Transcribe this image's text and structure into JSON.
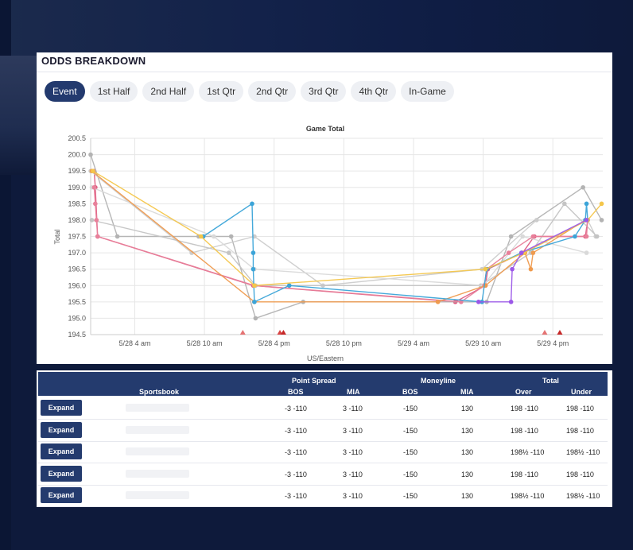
{
  "panel": {
    "title": "ODDS BREAKDOWN"
  },
  "tabs": [
    {
      "label": "Event",
      "active": true
    },
    {
      "label": "1st Half",
      "active": false
    },
    {
      "label": "2nd Half",
      "active": false
    },
    {
      "label": "1st Qtr",
      "active": false
    },
    {
      "label": "2nd Qtr",
      "active": false
    },
    {
      "label": "3rd Qtr",
      "active": false
    },
    {
      "label": "4th Qtr",
      "active": false
    },
    {
      "label": "In-Game",
      "active": false
    }
  ],
  "chart_data": {
    "type": "line",
    "title": "Game Total",
    "xlabel": "US/Eastern",
    "ylabel": "Total",
    "ylim": [
      194.5,
      200.5
    ],
    "yticks": [
      "200.5",
      "200.0",
      "199.5",
      "199.0",
      "198.5",
      "198.0",
      "197.5",
      "197.0",
      "196.5",
      "196.0",
      "195.5",
      "195.0",
      "194.5"
    ],
    "xticks": [
      "5/28 4 am",
      "5/28 10 am",
      "5/28 4 pm",
      "5/28 10 pm",
      "5/29 4 am",
      "5/29 10 am",
      "5/29 4 pm"
    ],
    "xticks_hours": [
      4,
      10,
      16,
      22,
      28,
      34,
      40
    ],
    "xlim_hours": [
      0.2,
      44.3
    ],
    "grid": true,
    "series": [
      {
        "color": "#e8809a",
        "points": [
          [
            0.5,
            199.0
          ],
          [
            0.6,
            198.5
          ],
          [
            0.7,
            198.0
          ],
          [
            0.8,
            197.5
          ],
          [
            14.3,
            196.0
          ],
          [
            32.1,
            195.5
          ],
          [
            34.1,
            196.0
          ],
          [
            34.3,
            196.5
          ],
          [
            36.2,
            197.0
          ],
          [
            38.3,
            197.5
          ],
          [
            42.9,
            197.5
          ],
          [
            43.0,
            198.0
          ]
        ]
      },
      {
        "color": "#dd5b80",
        "points": [
          [
            0.5,
            199.5
          ],
          [
            0.6,
            199.0
          ],
          [
            0.8,
            197.5
          ],
          [
            14.2,
            196.0
          ],
          [
            31.6,
            195.5
          ],
          [
            34.2,
            196.0
          ],
          [
            34.4,
            196.5
          ],
          [
            37.4,
            197.0
          ],
          [
            38.4,
            197.5
          ],
          [
            42.8,
            197.5
          ],
          [
            43.0,
            198.0
          ]
        ]
      },
      {
        "color": "#ef9a4d",
        "points": [
          [
            0.3,
            199.5
          ],
          [
            14.3,
            195.5
          ],
          [
            30.1,
            195.5
          ],
          [
            34.2,
            196.0
          ],
          [
            37.6,
            197.0
          ],
          [
            38.1,
            196.5
          ],
          [
            38.3,
            197.0
          ],
          [
            42.8,
            198.0
          ]
        ]
      },
      {
        "color": "#3ba4d8",
        "points": [
          [
            9.9,
            197.5
          ],
          [
            14.1,
            198.5
          ],
          [
            14.2,
            197.0
          ],
          [
            14.2,
            196.5
          ],
          [
            14.3,
            195.5
          ],
          [
            17.3,
            196.0
          ],
          [
            33.9,
            195.5
          ],
          [
            34.3,
            196.5
          ],
          [
            37.3,
            197.0
          ],
          [
            41.9,
            197.5
          ],
          [
            42.8,
            198.0
          ],
          [
            42.9,
            198.5
          ],
          [
            43.0,
            198.0
          ]
        ]
      },
      {
        "color": "#f4c64a",
        "points": [
          [
            0.4,
            199.5
          ],
          [
            9.7,
            197.5
          ],
          [
            14.3,
            196.0
          ],
          [
            34.2,
            196.5
          ],
          [
            37.5,
            197.0
          ],
          [
            43.0,
            198.0
          ],
          [
            44.2,
            198.5
          ]
        ]
      },
      {
        "color": "#9b57e8",
        "points": [
          [
            33.6,
            195.5
          ],
          [
            36.4,
            195.5
          ],
          [
            36.5,
            196.5
          ],
          [
            37.3,
            197.0
          ],
          [
            42.9,
            198.0
          ]
        ]
      },
      {
        "color": "#b3b3b3",
        "points": [
          [
            0.2,
            200.0
          ],
          [
            2.5,
            197.5
          ],
          [
            9.5,
            197.5
          ],
          [
            12.3,
            197.5
          ],
          [
            14.4,
            195.0
          ],
          [
            18.5,
            195.5
          ],
          [
            34.3,
            195.5
          ],
          [
            36.4,
            197.5
          ],
          [
            42.6,
            199.0
          ],
          [
            44.2,
            198.0
          ]
        ]
      },
      {
        "color": "#cccccc",
        "points": [
          [
            0.2,
            199.5
          ],
          [
            8.9,
            197.0
          ],
          [
            14.3,
            197.5
          ],
          [
            20.2,
            196.0
          ],
          [
            33.9,
            196.5
          ],
          [
            38.6,
            198.0
          ],
          [
            43.0,
            198.0
          ],
          [
            43.7,
            197.5
          ]
        ]
      },
      {
        "color": "#c4c4c4",
        "points": [
          [
            0.3,
            198.0
          ],
          [
            12.1,
            197.0
          ],
          [
            14.4,
            196.0
          ],
          [
            33.8,
            196.0
          ],
          [
            38.1,
            197.0
          ],
          [
            41.0,
            198.5
          ],
          [
            43.8,
            197.5
          ]
        ]
      },
      {
        "color": "#d9d9d9",
        "points": [
          [
            0.3,
            199.0
          ],
          [
            10.8,
            197.5
          ],
          [
            14.3,
            196.5
          ],
          [
            34.0,
            196.0
          ],
          [
            37.4,
            197.5
          ],
          [
            42.9,
            197.0
          ]
        ]
      }
    ],
    "markers": [
      {
        "x_hours": 13.3,
        "color": "#e57373"
      },
      {
        "x_hours": 16.5,
        "color": "#d84343"
      },
      {
        "x_hours": 16.8,
        "color": "#c62828"
      },
      {
        "x_hours": 39.3,
        "color": "#e57373"
      },
      {
        "x_hours": 40.6,
        "color": "#c62828"
      }
    ]
  },
  "table": {
    "group_headers": {
      "spread": "Point Spread",
      "moneyline": "Moneyline",
      "total": "Total"
    },
    "columns": {
      "book": "Sportsbook",
      "bos": "BOS",
      "mia": "MIA",
      "ml_bos": "BOS",
      "ml_mia": "MIA",
      "over": "Over",
      "under": "Under"
    },
    "expand_label": "Expand",
    "rows": [
      {
        "bos": "-3 -110",
        "mia": "3 -110",
        "ml_bos": "-150",
        "ml_mia": "130",
        "over": "198 -110",
        "under": "198 -110"
      },
      {
        "bos": "-3 -110",
        "mia": "3 -110",
        "ml_bos": "-150",
        "ml_mia": "130",
        "over": "198 -110",
        "under": "198 -110"
      },
      {
        "bos": "-3 -110",
        "mia": "3 -110",
        "ml_bos": "-150",
        "ml_mia": "130",
        "over": "198½ -110",
        "under": "198½ -110"
      },
      {
        "bos": "-3 -110",
        "mia": "3 -110",
        "ml_bos": "-150",
        "ml_mia": "130",
        "over": "198 -110",
        "under": "198 -110"
      },
      {
        "bos": "-3 -110",
        "mia": "3 -110",
        "ml_bos": "-150",
        "ml_mia": "130",
        "over": "198½ -110",
        "under": "198½ -110"
      }
    ]
  }
}
